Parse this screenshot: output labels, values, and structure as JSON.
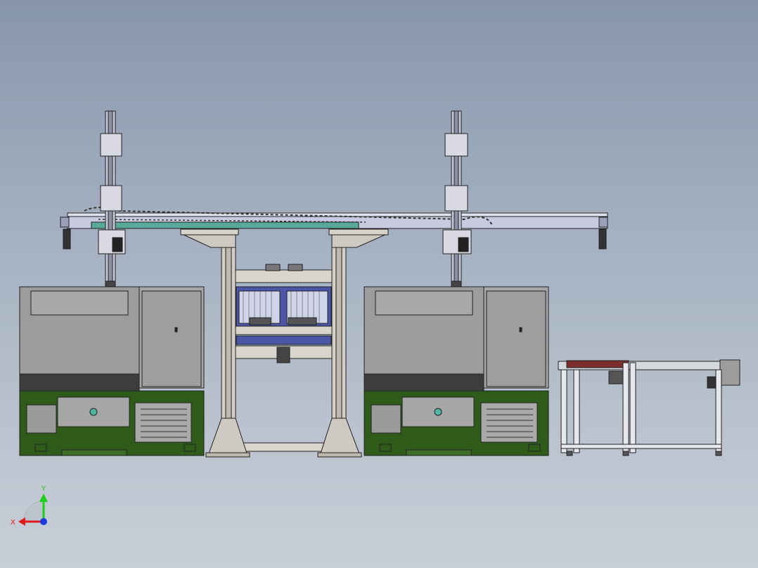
{
  "colors": {
    "background_top": "#8796ab",
    "background_bottom": "#c9cfd8",
    "machine_body": "#9c9c9c",
    "machine_dark": "#3d3d3d",
    "machine_base": "#2f5b1a",
    "frame": "#cdc8bf",
    "rail": "#c8cbe0",
    "rail_accent": "#5aa89a",
    "fixture_blue": "#4b57a6",
    "roller": "#7a2e2e",
    "axis_x": "#e21b1b",
    "axis_y": "#1bd01b",
    "axis_z": "#1b3be2"
  },
  "triad": {
    "x_label": "X",
    "y_label": "Y"
  }
}
